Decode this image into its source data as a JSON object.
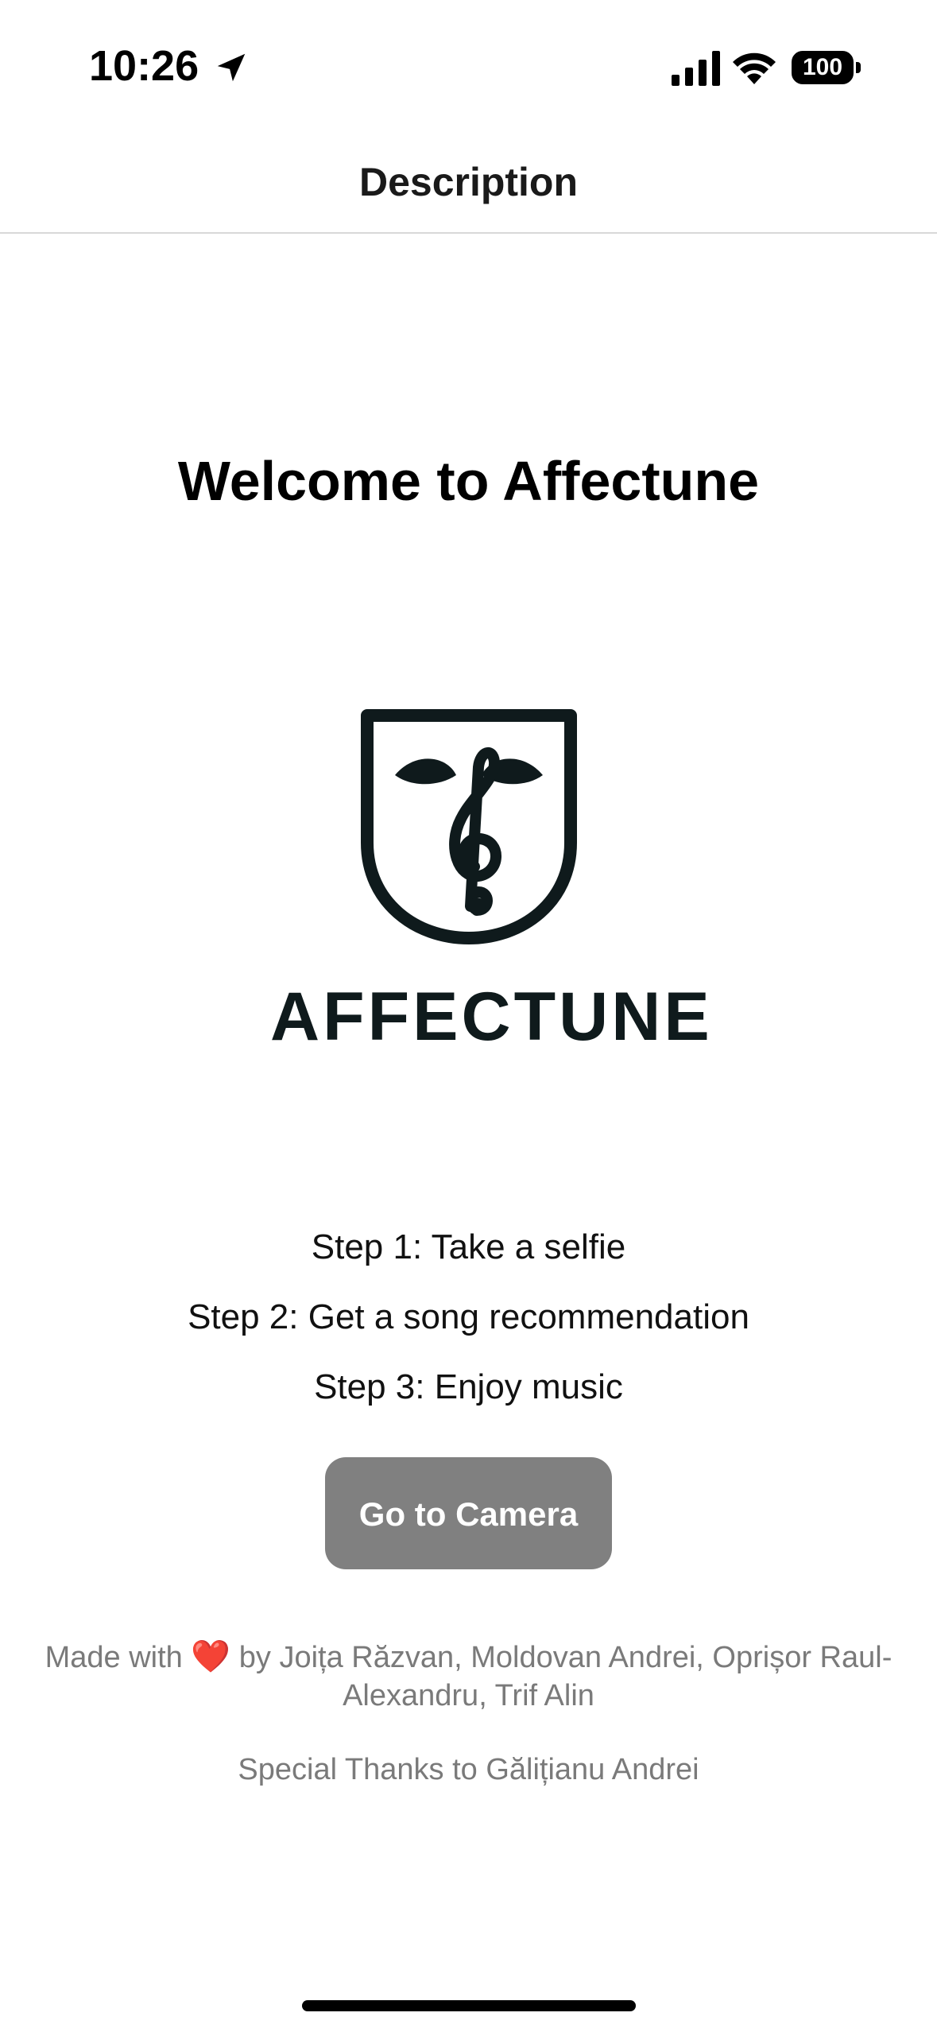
{
  "status_bar": {
    "time": "10:26",
    "battery_level": "100",
    "icons": [
      "location-arrow-icon",
      "cellular-signal-icon",
      "wifi-icon",
      "battery-icon"
    ]
  },
  "nav": {
    "title": "Description"
  },
  "main": {
    "welcome_title": "Welcome to Affectune",
    "logo_wordmark": "AFFECTUNE",
    "steps": [
      "Step 1: Take a selfie",
      "Step 2: Get a song recommendation",
      "Step 3: Enjoy music"
    ],
    "camera_button_label": "Go to Camera"
  },
  "footer": {
    "made_with_prefix": "Made with",
    "heart": "❤️",
    "made_with_suffix": " by Joița Răzvan, Moldovan Andrei, Oprișor Raul-Alexandru, Trif Alin",
    "special_thanks": "Special Thanks to Gălițianu Andrei"
  },
  "colors": {
    "button_bg": "#808080",
    "logo_dark": "#0f1a1c",
    "credits_text": "#7a7a7a",
    "heart": "#e0112b"
  }
}
